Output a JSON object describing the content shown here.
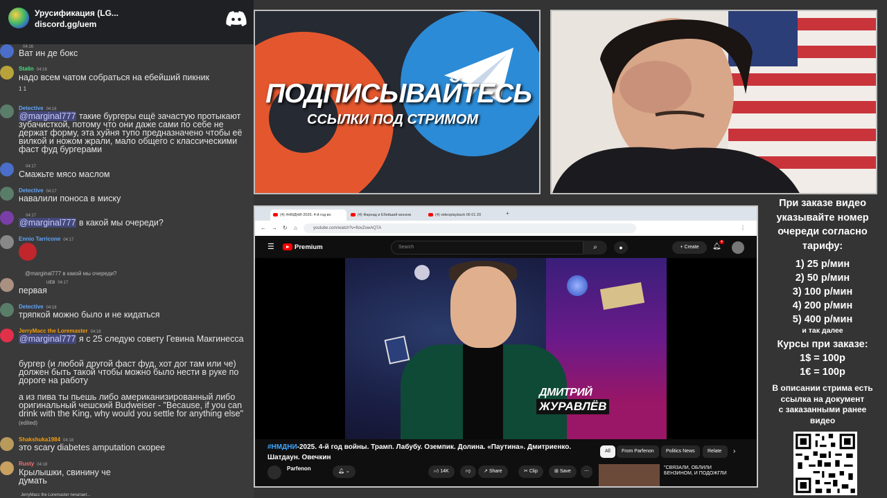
{
  "discord": {
    "server_name": "Урусификация (LG...",
    "invite": "discord.gg/uem",
    "messages": [
      {
        "user": "",
        "time": "04:16",
        "text": "Ват ин де бокс"
      },
      {
        "user": "Stalin",
        "time": "04:16",
        "text": "надо всем чатом собраться на ебейший пикник",
        "reactions": "1   1"
      },
      {
        "user": "Detective",
        "time": "04:16",
        "mention": "@marginal777",
        "text": " такие бургеры ещё зачастую протыкают зубачисткой, потому что они даже сами по себе не держат форму, эта хуйня тупо предназначено чтобы её вилкой и ножом жрали, мало общего с классическими фаст фуд бургерами"
      },
      {
        "user": "",
        "time": "04:17",
        "text": "Смажьте мясо маслом"
      },
      {
        "user": "Detective",
        "time": "04:17",
        "text": "навалили поноса в миску"
      },
      {
        "user": "",
        "time": "04:17",
        "mention": "@marginal777",
        "text": " в какой мы очереди?"
      },
      {
        "user": "Ennio Tarricone",
        "time": "04:17",
        "text": ""
      },
      {
        "reply": "@marginal777 в какой мы очереди?",
        "user": "",
        "badge": "UEB",
        "time": "04:17",
        "text": "первая"
      },
      {
        "user": "Detective",
        "time": "04:18",
        "text": "тряпкой можно было и не кидаться"
      },
      {
        "user": "JerryMacc the Loremaster",
        "time": "04:18",
        "mention": "@marginal777",
        "text": " я с 25 следую совету Гевина Макгинесса"
      },
      {
        "text": "бургер (и любой другой фаст фуд, хот дог там или че) должен быть такой чтобы можно было нести в руке по дороге на работу"
      },
      {
        "text": "а из пива ты пьешь либо американизированный либо оригинальный чешский Budweiser - \"Because, if you can drink with the King, why would you settle for anything else\"",
        "edited": "(edited)"
      },
      {
        "user": "Shakshuka1984",
        "time": "04:18",
        "text": "это scary diabetes amputation скорее"
      },
      {
        "user": "Rusty",
        "time": "04:18",
        "text": "Крылышки, свинину че думать"
      }
    ],
    "typing": "JerryMacc the Loremaster печатает..."
  },
  "promo": {
    "line1": "ПОДПИСЫВАЙТЕСЬ",
    "line2": "ССЫЛКИ ПОД СТРИМОМ"
  },
  "browser": {
    "tabs": [
      "(4) #НМДНИ-2025. 4-й год во",
      "(4) Фарнад и Ебейший москов",
      "(4) videoplayback 06 01 20"
    ],
    "url": "youtube.com/watch?v=flovZowAQ7A",
    "premium": "Premium",
    "search_placeholder": "Search",
    "create": "Create",
    "notif_count": "4",
    "thumb_name1": "ДМИТРИЙ",
    "thumb_name2": "ЖУРАВЛЁВ",
    "hashtag": "#НМДНИ",
    "title": "-2025. 4-й год войны. Трамп. Лабубу. Оземпик. Долина. «Паутина». Дмитриенко. Шатдаун. Овечкин",
    "chips": [
      "All",
      "From Parfenon",
      "Politics News",
      "Relate"
    ],
    "channel": "Parfenon",
    "likes": "14K",
    "share": "Share",
    "clip": "Clip",
    "save": "Save",
    "rec_title": "\"СВЯЗАЛИ, ОБЛИЛИ БЕНЗИНОМ, И ПОДОЖГЛИ"
  },
  "info": {
    "header": [
      "При заказе видео",
      "указывайте номер",
      "очереди согласно",
      "тарифу:"
    ],
    "prices": [
      "1) 25 р/мин",
      "2) 50 р/мин",
      "3) 100 р/мин",
      "4) 200 р/мин",
      "5) 400 р/мин"
    ],
    "etc": "и так далее",
    "courses_title": "Курсы при заказе:",
    "courses": [
      "1$ = 100р",
      "1€ = 100р"
    ],
    "desc": [
      "В описании стрима есть",
      "ссылка на документ",
      "с заказанными ранее",
      "видео"
    ]
  },
  "colors": {
    "discord_bg": "#3a3a3b",
    "mention": "#c9cdfb",
    "yt_red": "#ff0000",
    "promo_orange": "#e4572e",
    "promo_blue": "#2c8bd6"
  }
}
